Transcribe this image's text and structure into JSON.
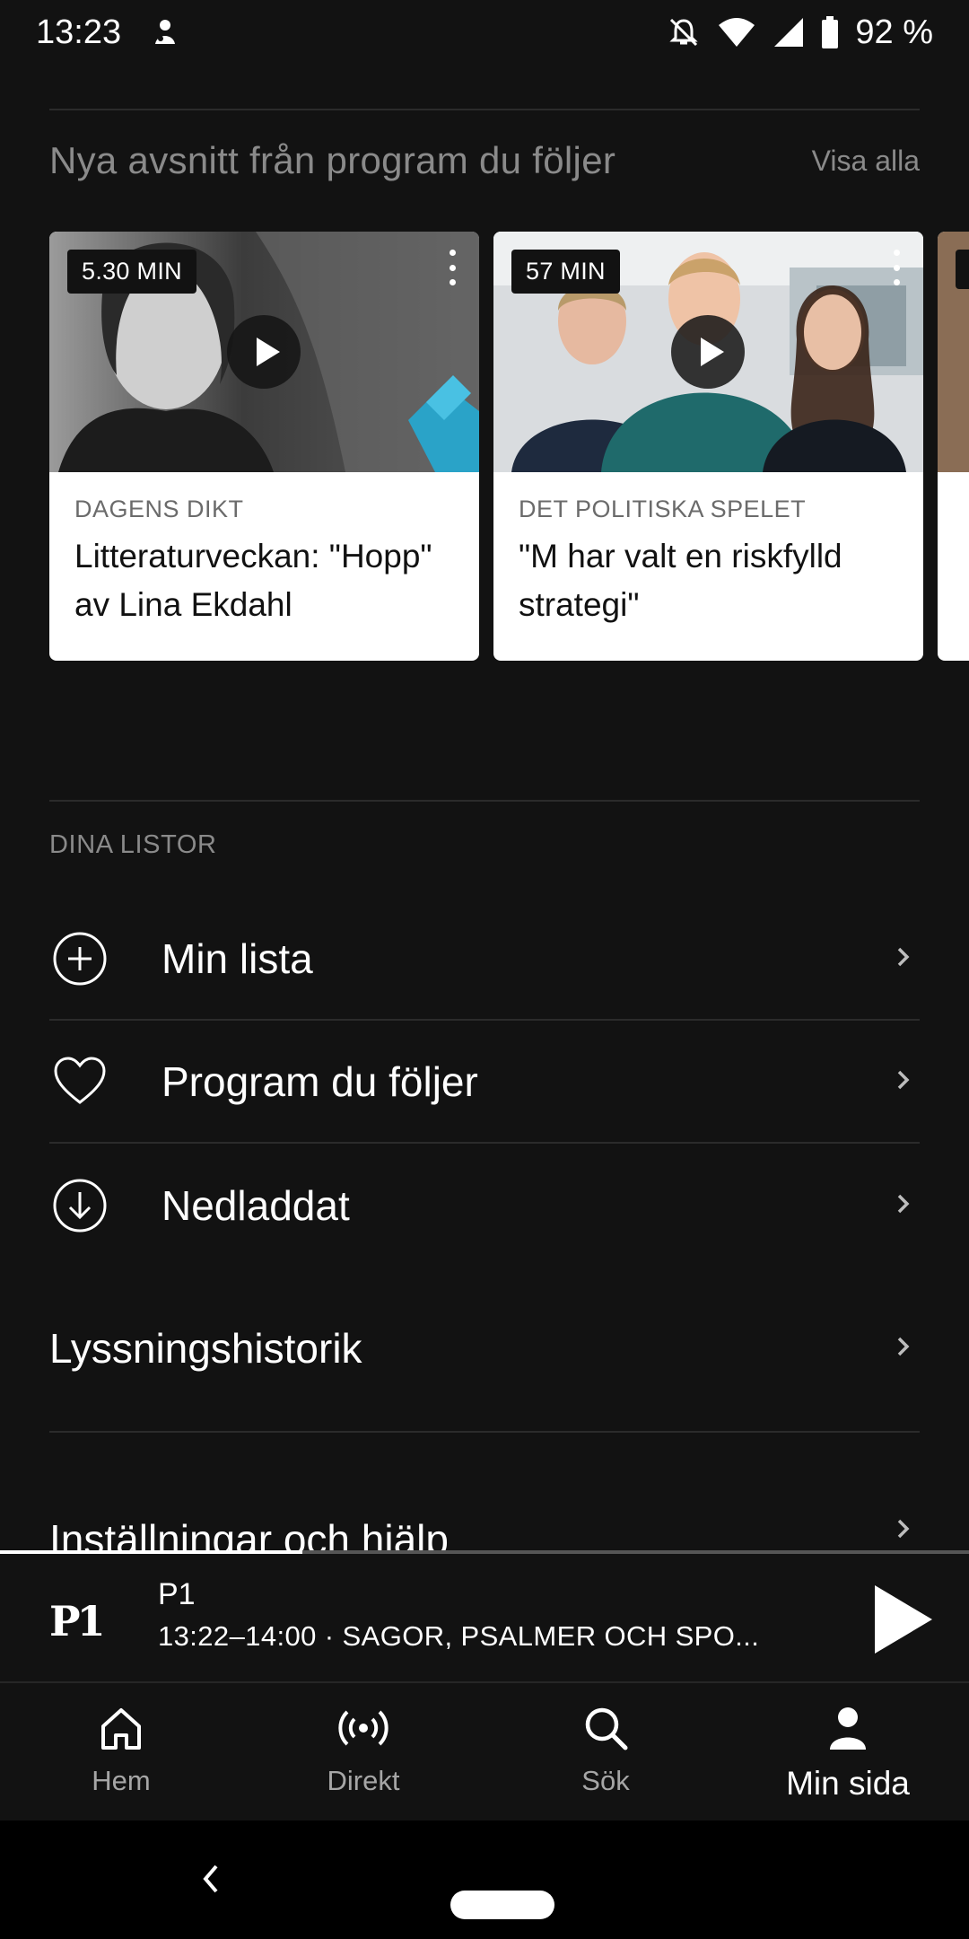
{
  "status_bar": {
    "time": "13:23",
    "battery": "92 %",
    "icons": [
      "notification-app-icon",
      "do-not-disturb-off-icon",
      "wifi-icon",
      "signal-icon",
      "battery-icon"
    ]
  },
  "new_episodes": {
    "title": "Nya avsnitt från program du följer",
    "see_all": "Visa alla",
    "cards": [
      {
        "duration": "5.30 MIN",
        "program": "DAGENS DIKT",
        "title": "Litteraturveckan: \"Hopp\" av Lina Ekdahl"
      },
      {
        "duration": "57 MIN",
        "program": "DET POLITISKA SPELET",
        "title": "\"M har valt en riskfylld strategi\""
      }
    ]
  },
  "lists": {
    "label": "DINA LISTOR",
    "items": [
      {
        "label": "Min lista",
        "icon": "plus-circle-icon"
      },
      {
        "label": "Program du följer",
        "icon": "heart-icon"
      },
      {
        "label": "Nedladdat",
        "icon": "download-icon"
      }
    ]
  },
  "links": [
    {
      "label": "Lyssningshistorik"
    },
    {
      "label": "Inställningar och hjälp"
    }
  ],
  "player": {
    "logo": "P1",
    "channel": "P1",
    "now_playing": "13:22–14:00 · SAGOR, PSALMER OCH SPO...",
    "progress": 0.31
  },
  "bottom_nav": {
    "items": [
      {
        "label": "Hem",
        "icon": "home-icon"
      },
      {
        "label": "Direkt",
        "icon": "live-icon"
      },
      {
        "label": "Sök",
        "icon": "search-icon"
      },
      {
        "label": "Min sida",
        "icon": "person-icon",
        "active": true
      }
    ]
  },
  "colors": {
    "background": "#121212",
    "text": "#ffffff",
    "muted": "#8a8a8a",
    "card": "#ffffff"
  }
}
